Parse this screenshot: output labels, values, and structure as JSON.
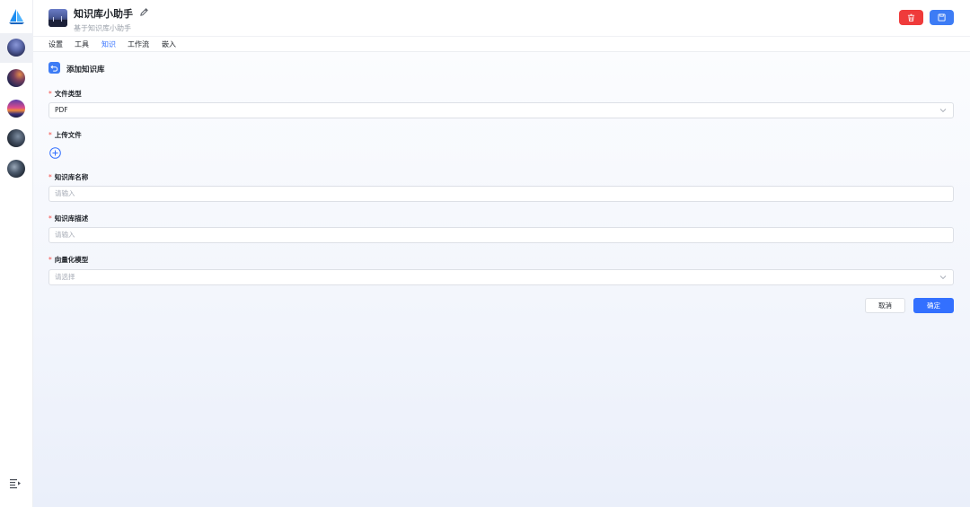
{
  "app": {
    "title": "知识库小助手",
    "subtitle": "基于知识库小助手"
  },
  "tabs": [
    {
      "label": "设置",
      "active": false
    },
    {
      "label": "工具",
      "active": false
    },
    {
      "label": "知识",
      "active": true
    },
    {
      "label": "工作流",
      "active": false
    },
    {
      "label": "嵌入",
      "active": false
    }
  ],
  "sidebar": {
    "logo": "sail-logo",
    "avatars": [
      "landscape-avatar-1",
      "landscape-avatar-2",
      "landscape-avatar-3",
      "landscape-avatar-4",
      "landscape-avatar-5"
    ],
    "menu_icon": "collapse-menu-icon"
  },
  "header_actions": {
    "delete_icon": "trash-icon",
    "save_icon": "save-icon"
  },
  "form": {
    "title": "添加知识库",
    "required_mark": "*",
    "file_type": {
      "label": "文件类型",
      "value": "PDF"
    },
    "upload": {
      "label": "上传文件"
    },
    "kb_name": {
      "label": "知识库名称",
      "placeholder": "请输入"
    },
    "kb_desc": {
      "label": "知识库描述",
      "placeholder": "请输入"
    },
    "embed_model": {
      "label": "向量化模型",
      "placeholder": "请选择"
    },
    "cancel_label": "取消",
    "confirm_label": "确定"
  },
  "colors": {
    "primary": "#3370ff",
    "danger": "#ef3b3b",
    "required": "#f54a45"
  }
}
